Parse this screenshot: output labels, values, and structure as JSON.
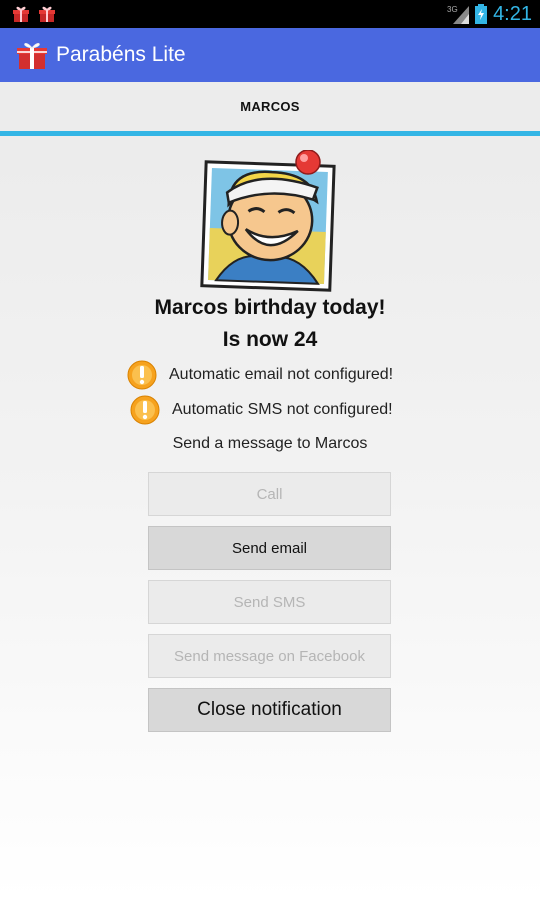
{
  "status_bar": {
    "time": "4:21",
    "network_type": "3G",
    "icons": [
      "gift-icon",
      "gift-icon",
      "signal-icon",
      "battery-icon"
    ]
  },
  "action_bar": {
    "title": "Parabéns Lite",
    "icon": "gift-icon",
    "color": "#4a68e0"
  },
  "tab": {
    "label": "MARCOS",
    "indicator_color": "#33b5e5"
  },
  "main": {
    "avatar": "cartoon-avatar-image",
    "headline": "Marcos birthday today!",
    "age_line": "Is now 24",
    "warnings": [
      {
        "icon": "warning-icon",
        "text": "Automatic email not configured!"
      },
      {
        "icon": "warning-icon",
        "text": "Automatic SMS not configured!"
      }
    ],
    "prompt": "Send a message to Marcos",
    "buttons": {
      "call": "Call",
      "email": "Send email",
      "sms": "Send SMS",
      "facebook": "Send message on Facebook",
      "close": "Close notification"
    }
  }
}
